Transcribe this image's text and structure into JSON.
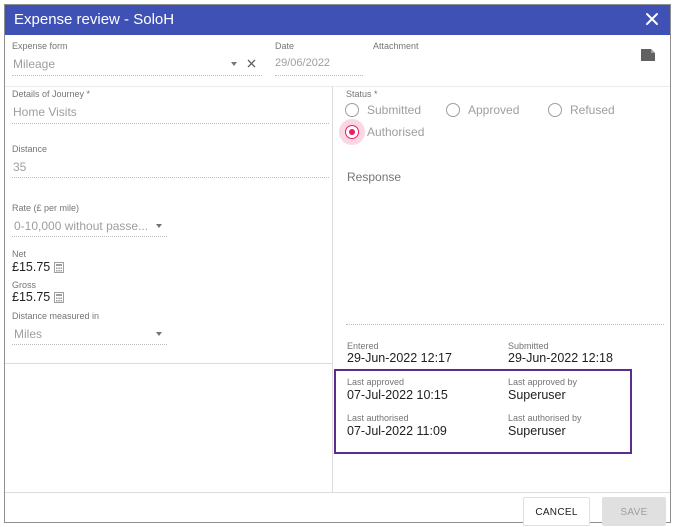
{
  "dialog": {
    "title": "Expense review - SoloH",
    "close_icon": "close-icon"
  },
  "form": {
    "expense_form": {
      "label": "Expense form",
      "value": "Mileage"
    },
    "date": {
      "label": "Date",
      "value": "29/06/2022"
    },
    "attachment": {
      "label": "Attachment",
      "icon": "attachment-file-icon"
    },
    "journey": {
      "label": "Details of Journey *",
      "value": "Home Visits"
    },
    "distance": {
      "label": "Distance",
      "value": "35"
    },
    "rate": {
      "label": "Rate (£ per mile)",
      "value": "0-10,000 without passe..."
    },
    "net": {
      "label": "Net",
      "value": "£15.75"
    },
    "gross": {
      "label": "Gross",
      "value": "£15.75"
    },
    "distance_unit": {
      "label": "Distance measured in",
      "value": "Miles"
    }
  },
  "status": {
    "label": "Status *",
    "options": [
      "Submitted",
      "Approved",
      "Refused",
      "Authorised"
    ],
    "selected": "Authorised"
  },
  "response": {
    "label": "Response",
    "value": ""
  },
  "audit": {
    "entered": {
      "label": "Entered",
      "value": "29-Jun-2022 12:17"
    },
    "submitted": {
      "label": "Submitted",
      "value": "29-Jun-2022 12:18"
    },
    "last_approved": {
      "label": "Last approved",
      "value": "07-Jul-2022 10:15"
    },
    "last_approved_by": {
      "label": "Last approved by",
      "value": "Superuser"
    },
    "last_authorised": {
      "label": "Last authorised",
      "value": "07-Jul-2022 11:09"
    },
    "last_authorised_by": {
      "label": "Last authorised by",
      "value": "Superuser"
    }
  },
  "footer": {
    "cancel_label": "CANCEL",
    "save_label": "SAVE"
  },
  "colors": {
    "titlebar": "#3f51b5",
    "radio_selected": "#e91e63",
    "highlight_border": "#5c2d91"
  }
}
